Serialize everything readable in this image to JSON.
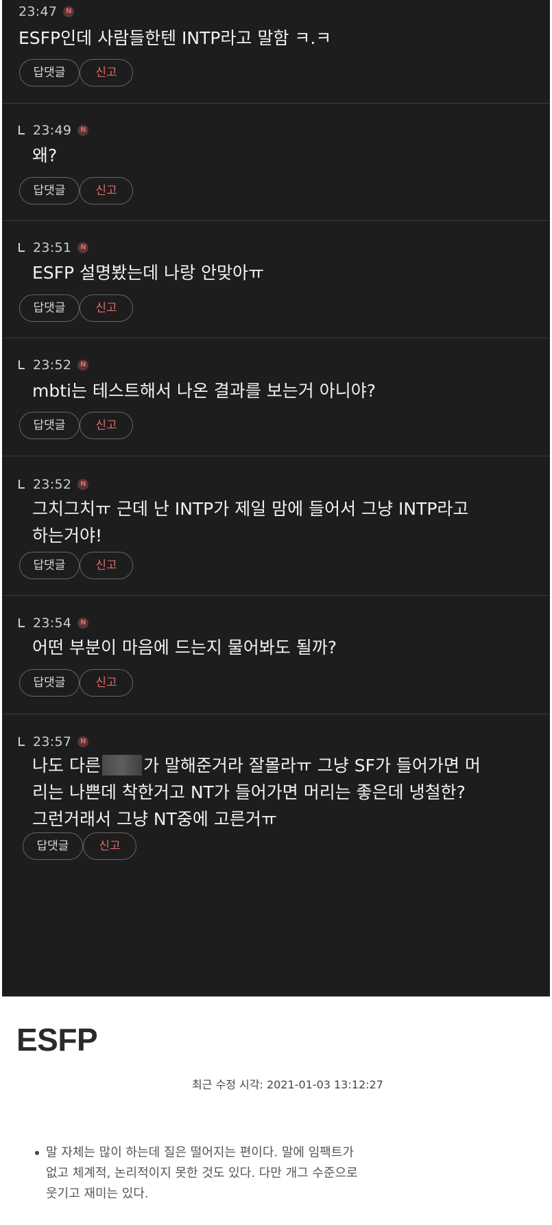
{
  "buttons": {
    "reply": "답댓글",
    "report": "신고"
  },
  "new_badge": "N",
  "comments": [
    {
      "time": "23:47",
      "lines": [
        "ESFP인데 사람들한텐 INTP라고 말함 ㅋ.ㅋ"
      ]
    },
    {
      "time": "23:49",
      "lines": [
        "왜?"
      ]
    },
    {
      "time": "23:51",
      "lines": [
        "ESFP 설명봤는데 나랑 안맞아ㅠ"
      ]
    },
    {
      "time": "23:52",
      "lines": [
        "mbti는 테스트해서 나온 결과를 보는거 아니야?"
      ]
    },
    {
      "time": "23:52",
      "lines": [
        "그치그치ㅠ 근데 난 INTP가 제일 맘에 들어서 그냥 INTP라고",
        "하는거야!"
      ]
    },
    {
      "time": "23:54",
      "lines": [
        "어떤 부분이 마음에 드는지 물어봐도 될까?"
      ]
    },
    {
      "time": "23:57",
      "line1_before": "나도 다른",
      "line1_after": "가 말해준거라 잘몰라ㅠ 그냥 SF가 들어가면 머",
      "lines_rest": [
        "리는 나쁜데 착한거고 NT가 들어가면 머리는 좋은데 냉철한?",
        "그런거래서 그냥 NT중에 고른거ㅠ"
      ]
    }
  ],
  "document": {
    "title": "ESFP",
    "edit_time": "최근 수정 시각: 2021-01-03 13:12:27",
    "bullet_lines": [
      "말 자체는 많이 하는데 질은 떨어지는 편이다. 말에 임팩트가",
      "없고 체계적, 논리적이지 못한 것도 있다. 다만 개그 수준으로",
      "웃기고 재미는 있다."
    ]
  }
}
